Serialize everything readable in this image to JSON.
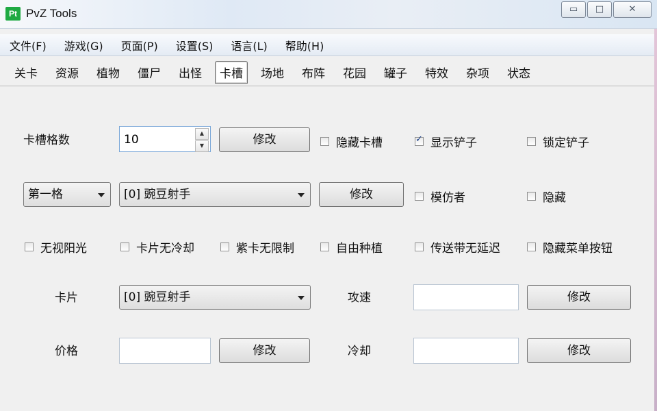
{
  "window": {
    "app_icon_text": "Pt",
    "title": "PvZ Tools",
    "minimize": "▭",
    "maximize": "□",
    "close": "✕"
  },
  "menu": [
    "文件(F)",
    "游戏(G)",
    "页面(P)",
    "设置(S)",
    "语言(L)",
    "帮助(H)"
  ],
  "tabs": [
    "关卡",
    "资源",
    "植物",
    "僵尸",
    "出怪",
    "卡槽",
    "场地",
    "布阵",
    "花园",
    "罐子",
    "特效",
    "杂项",
    "状态"
  ],
  "active_tab": "卡槽",
  "slots": {
    "count_label": "卡槽格数",
    "count_value": "10",
    "count_modify": "修改",
    "hide_slot": "隐藏卡槽",
    "show_shovel": "显示铲子",
    "lock_shovel": "锁定铲子",
    "slot_select": "第一格",
    "slot_plant": "[0] 豌豆射手",
    "slot_modify": "修改",
    "imitater": "模仿者",
    "hide": "隐藏"
  },
  "options": {
    "ignore_sun": "无视阳光",
    "no_cooldown": "卡片无冷却",
    "purple_unlimited": "紫卡无限制",
    "free_planting": "自由种植",
    "conveyor_no_delay": "传送带无延迟",
    "hide_menu_button": "隐藏菜单按钮"
  },
  "card": {
    "label": "卡片",
    "plant": "[0] 豌豆射手",
    "attack_speed_label": "攻速",
    "attack_speed_value": "",
    "attack_speed_modify": "修改",
    "price_label": "价格",
    "price_value": "",
    "price_modify": "修改",
    "cooldown_label": "冷却",
    "cooldown_value": "",
    "cooldown_modify": "修改"
  },
  "icons": {
    "spin_up": "▲",
    "spin_down": "▼"
  },
  "colors": {
    "app_icon_bg": "#1faa43",
    "check_mark": "#1a3f86",
    "spin_border": "#7aa7d8"
  }
}
